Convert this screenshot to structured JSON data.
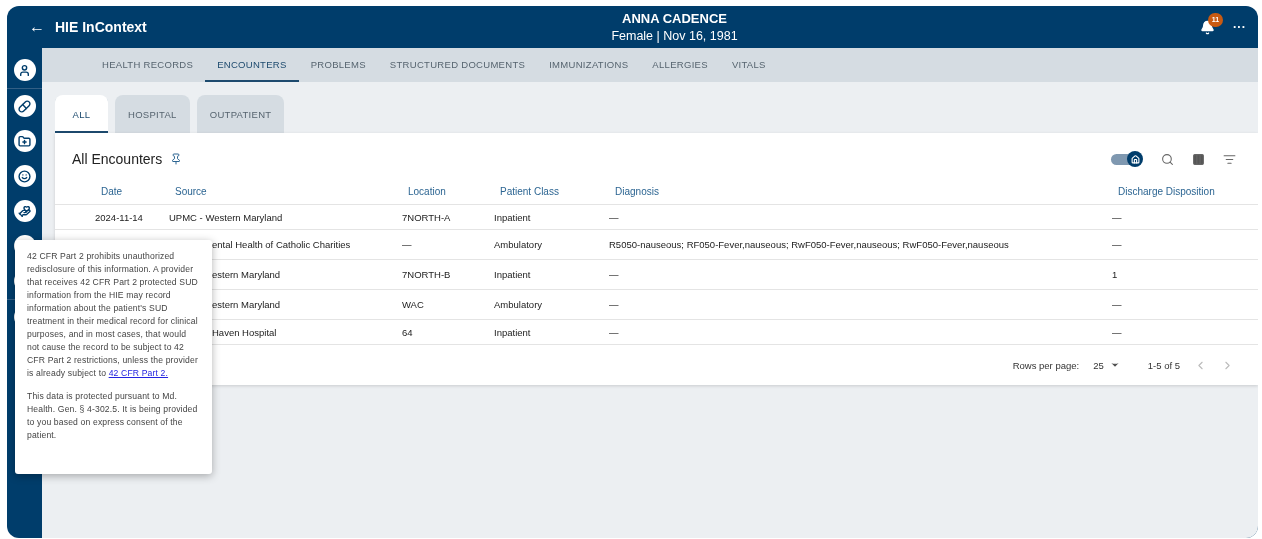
{
  "header": {
    "back_label": "←",
    "app_title": "HIE InContext",
    "patient_name": "ANNA CADENCE",
    "patient_info": "Female | Nov 16, 1981",
    "notification_count": "11",
    "more_label": "..."
  },
  "tabs": [
    {
      "label": "HEALTH RECORDS",
      "selected": false
    },
    {
      "label": "ENCOUNTERS",
      "selected": true
    },
    {
      "label": "PROBLEMS",
      "selected": false
    },
    {
      "label": "STRUCTURED DOCUMENTS",
      "selected": false
    },
    {
      "label": "IMMUNIZATIONS",
      "selected": false
    },
    {
      "label": "ALLERGIES",
      "selected": false
    },
    {
      "label": "VITALS",
      "selected": false
    }
  ],
  "subtabs": [
    {
      "label": "ALL",
      "selected": true
    },
    {
      "label": "HOSPITAL",
      "selected": false
    },
    {
      "label": "OUTPATIENT",
      "selected": false
    }
  ],
  "card": {
    "title": "All Encounters",
    "home_toggle": {
      "on": true
    }
  },
  "table": {
    "columns": [
      "Date",
      "Source",
      "Location",
      "Patient Class",
      "Diagnosis",
      "Discharge Disposition"
    ],
    "rows": [
      {
        "date": "2024-11-14",
        "source": "UPMC - Western Maryland",
        "location": "7NORTH-A",
        "patient_class": "Inpatient",
        "diagnosis": "—",
        "discharge_disposition": "—"
      },
      {
        "source": "ental Health of Catholic Charities",
        "location": "—",
        "patient_class": "Ambulatory",
        "diagnosis": "R5050-nauseous; RF050-Fever,nauseous; RwF050-Fever,nauseous; RwF050-Fever,nauseous",
        "discharge_disposition": "—"
      },
      {
        "source": "estern Maryland",
        "location": "7NORTH-B",
        "patient_class": "Inpatient",
        "diagnosis": "—",
        "discharge_disposition": "1"
      },
      {
        "source": "estern Maryland",
        "location": "WAC",
        "patient_class": "Ambulatory",
        "diagnosis": "—",
        "discharge_disposition": "—"
      },
      {
        "source": "Haven Hospital",
        "location": "64",
        "patient_class": "Inpatient",
        "diagnosis": "—",
        "discharge_disposition": "—"
      }
    ]
  },
  "pagination": {
    "rows_per_page_label": "Rows per page:",
    "rows_per_page": "25",
    "range": "1-5 of 5"
  },
  "tooltip": {
    "paragraphs": [
      {
        "text": "42 CFR Part 2 prohibits unauthorized redisclosure of this information. A provider that receives 42 CFR Part 2 protected SUD information from the HIE may record information about the patient's SUD treatment in their medical record for clinical purposes, and in most cases, that would not cause the record to be subject to 42 CFR Part 2 restrictions, unless the provider is already subject to ",
        "link": "42 CFR Part 2."
      },
      {
        "text": "This data is protected pursuant to Md. Health. Gen. § 4-302.5. It is being provided to you based on express consent of the patient."
      }
    ]
  }
}
